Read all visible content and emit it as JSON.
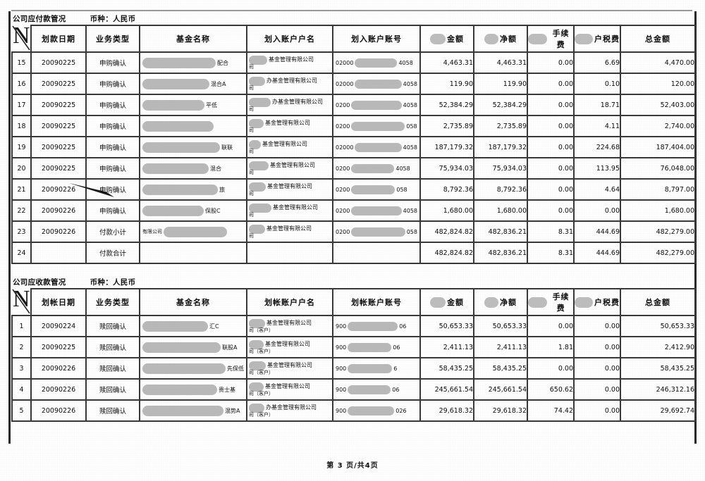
{
  "document": {
    "footer": "第 3 页/共4页"
  },
  "sections": [
    {
      "title": "公司应付款管况",
      "currency_label": "币种：人民币",
      "columns": {
        "no": "N",
        "date": "划款日期",
        "type": "业务类型",
        "fund_name": "基金名称",
        "account_name": "划入账户户名",
        "account_no": "划入账户账号",
        "amount": "金额",
        "net": "净额",
        "fee": "手续费",
        "tax": "户税费",
        "total": "总金额"
      },
      "rows": [
        {
          "no": "15",
          "date": "20090225",
          "type": "申购确认",
          "fund_name": "",
          "fund_suffix": "配合",
          "account_name": "基金管理有限公司",
          "account_name_sub": "司",
          "account_no_prefix": "02000",
          "account_no_suffix": "4058",
          "amount": "4,463.31",
          "net": "4,463.31",
          "fee": "0.00",
          "tax": "6.69",
          "total": "4,470.00"
        },
        {
          "no": "16",
          "date": "20090225",
          "type": "申购确认",
          "fund_name": "",
          "fund_suffix": "混合A",
          "account_name": "办基金管理有限公司",
          "account_name_sub": "司",
          "account_no_prefix": "02000",
          "account_no_suffix": "4058",
          "amount": "119.90",
          "net": "119.90",
          "fee": "0.00",
          "tax": "0.10",
          "total": "120.00"
        },
        {
          "no": "17",
          "date": "20090225",
          "type": "申购确认",
          "fund_name": "",
          "fund_suffix": "平低",
          "account_name": "办基金管理有限公司",
          "account_name_sub": "司",
          "account_no_prefix": "0200",
          "account_no_suffix": "4058",
          "amount": "52,384.29",
          "net": "52,384.29",
          "fee": "0.00",
          "tax": "18.71",
          "total": "52,403.00"
        },
        {
          "no": "18",
          "date": "20090225",
          "type": "申购确认",
          "fund_name": "",
          "fund_suffix": "",
          "account_name": "基金管理有限公司",
          "account_name_sub": "司",
          "account_no_prefix": "0200",
          "account_no_suffix": "058",
          "amount": "2,735.89",
          "net": "2,735.89",
          "fee": "0.00",
          "tax": "4.11",
          "total": "2,740.00"
        },
        {
          "no": "19",
          "date": "20090225",
          "type": "申购确认",
          "fund_name": "",
          "fund_suffix": "联联",
          "account_name": "基金管理有限公司",
          "account_name_sub": "司",
          "account_no_prefix": "02000",
          "account_no_suffix": "4058",
          "amount": "187,179.32",
          "net": "187,179.32",
          "fee": "0.00",
          "tax": "224.68",
          "total": "187,404.00"
        },
        {
          "no": "20",
          "date": "20090225",
          "type": "申购确认",
          "fund_name": "",
          "fund_suffix": "混合",
          "account_name": "基金管理有限公司",
          "account_name_sub": "司",
          "account_no_prefix": "0200",
          "account_no_suffix": "4058",
          "amount": "75,934.03",
          "net": "75,934.03",
          "fee": "0.00",
          "tax": "113.95",
          "total": "76,048.00"
        },
        {
          "no": "21",
          "date": "20090226",
          "type": "申购确认",
          "fund_name": "",
          "fund_suffix": "旅",
          "account_name": "基金管理有限公司",
          "account_name_sub": "司",
          "account_no_prefix": "0200",
          "account_no_suffix": "058",
          "amount": "8,792.36",
          "net": "8,792.36",
          "fee": "0.00",
          "tax": "4.64",
          "total": "8,797.00"
        },
        {
          "no": "22",
          "date": "20090226",
          "type": "申购确认",
          "fund_name": "",
          "fund_suffix": "保股C",
          "account_name": "基金管理有限公司",
          "account_name_sub": "司",
          "account_no_prefix": "0200",
          "account_no_suffix": "4058",
          "amount": "1,680.00",
          "net": "1,680.00",
          "fee": "0.00",
          "tax": "0.00",
          "total": "1,680.00"
        },
        {
          "no": "23",
          "date": "20090226",
          "type": "付款小计",
          "fund_name": "有限公司",
          "fund_suffix": "",
          "account_name": "基金管理有限公司",
          "account_name_sub": "司",
          "account_no_prefix": "0200",
          "account_no_suffix": "058",
          "amount": "482,824.82",
          "net": "482,836.21",
          "fee": "8.31",
          "tax": "444.69",
          "total": "482,279.00"
        },
        {
          "no": "24",
          "date": "",
          "type": "付款合计",
          "fund_name": "",
          "fund_suffix": "",
          "account_name": "",
          "account_name_sub": "",
          "account_no_prefix": "",
          "account_no_suffix": "",
          "amount": "482,824.82",
          "net": "482,836.21",
          "fee": "8.31",
          "tax": "444.69",
          "total": "482,279.00"
        }
      ]
    },
    {
      "title": "公司应收款管况",
      "currency_label": "币种：人民币",
      "columns": {
        "no": "N",
        "date": "划帐日期",
        "type": "业务类型",
        "fund_name": "基金名称",
        "account_name": "划帐账户户名",
        "account_no": "划帐账户账号",
        "amount": "金额",
        "net": "净额",
        "fee": "手续费",
        "tax": "户税费",
        "total": "总金额"
      },
      "rows": [
        {
          "no": "1",
          "date": "20090224",
          "type": "赎回确认",
          "fund_name": "",
          "fund_suffix": "汇C",
          "account_name": "基金管理有限公司",
          "account_name_sub": "司（客户）",
          "account_no_prefix": "900",
          "account_no_suffix": "06",
          "amount": "50,653.33",
          "net": "50,653.33",
          "fee": "0.00",
          "tax": "0.00",
          "total": "50,653.33"
        },
        {
          "no": "2",
          "date": "20090225",
          "type": "赎回确认",
          "fund_name": "",
          "fund_suffix": "联股A",
          "account_name": "基金管理有限公司",
          "account_name_sub": "司（客户）",
          "account_no_prefix": "900",
          "account_no_suffix": "06",
          "amount": "2,411.13",
          "net": "2,411.13",
          "fee": "1.81",
          "tax": "0.00",
          "total": "2,412.90"
        },
        {
          "no": "3",
          "date": "20090226",
          "type": "赎回确认",
          "fund_name": "",
          "fund_suffix": "先保低",
          "account_name": "基金管理有限公司",
          "account_name_sub": "司（客户）",
          "account_no_prefix": "900",
          "account_no_suffix": "6",
          "amount": "58,435.25",
          "net": "58,435.25",
          "fee": "0.00",
          "tax": "0.00",
          "total": "58,435.25"
        },
        {
          "no": "4",
          "date": "20090226",
          "type": "赎回确认",
          "fund_name": "",
          "fund_suffix": "贵士基",
          "account_name": "基金管理有限公司",
          "account_name_sub": "司（客户）",
          "account_no_prefix": "900",
          "account_no_suffix": "06",
          "amount": "245,661.54",
          "net": "245,661.54",
          "fee": "650.62",
          "tax": "0.00",
          "total": "246,312.16"
        },
        {
          "no": "5",
          "date": "20090226",
          "type": "赎回确认",
          "fund_name": "",
          "fund_suffix": "混势A",
          "account_name": "办基金管理有限公司",
          "account_name_sub": "司（客户）",
          "account_no_prefix": "900",
          "account_no_suffix": "026",
          "amount": "29,618.32",
          "net": "29,618.32",
          "fee": "74.42",
          "tax": "0.00",
          "total": "29,692.74"
        }
      ]
    }
  ]
}
